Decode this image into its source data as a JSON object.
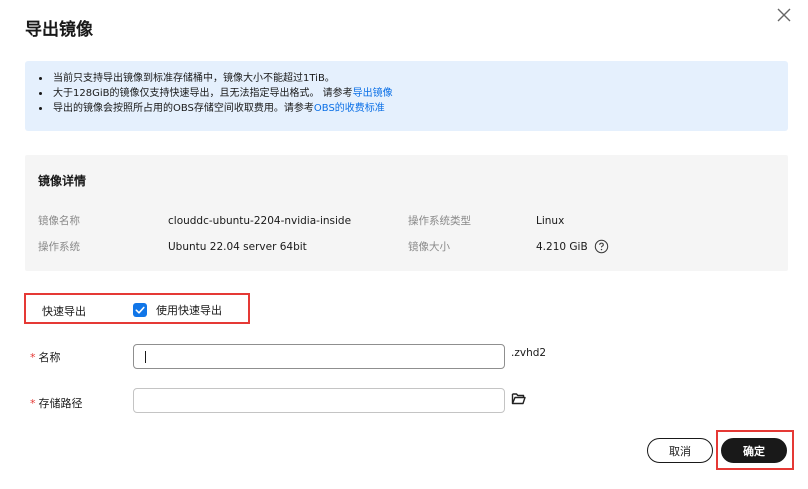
{
  "dialog": {
    "title": "导出镜像",
    "close_icon": "close-icon"
  },
  "notice": {
    "line1": "当前只支持导出镜像到标准存储桶中，镜像大小不能超过1TiB。",
    "line2_text": "大于128GiB的镜像仅支持快速导出，且无法指定导出格式。 请参考",
    "line2_link": "导出镜像",
    "line3_text": "导出的镜像会按照所占用的OBS存储空间收取费用。请参考",
    "line3_link": "OBS的收费标准"
  },
  "details": {
    "title": "镜像详情",
    "image_name_label": "镜像名称",
    "image_name_value": "clouddc-ubuntu-2204-nvidia-inside",
    "os_type_label": "操作系统类型",
    "os_type_value": "Linux",
    "os_label": "操作系统",
    "os_value": "Ubuntu 22.04 server 64bit",
    "size_label": "镜像大小",
    "size_value": "4.210 GiB",
    "help_icon": "question-circle-icon"
  },
  "form": {
    "fast_export_label": "快速导出",
    "fast_export_checkbox_label": "使用快速导出",
    "fast_export_checked": true,
    "name_required_mark": "*",
    "name_label": "名称",
    "name_value": "",
    "name_suffix": ".zvhd2",
    "path_required_mark": "*",
    "path_label": "存储路径",
    "path_value": "",
    "folder_icon": "folder-open-icon"
  },
  "actions": {
    "cancel_label": "取消",
    "ok_label": "确定"
  },
  "colors": {
    "primary_link": "#0a6fe6",
    "checkbox": "#1176e8",
    "required": "#e53935",
    "highlight_border": "#e53935",
    "notice_bg": "#e5f0fd",
    "details_bg": "#f5f5f5",
    "primary_button": "#191919"
  }
}
